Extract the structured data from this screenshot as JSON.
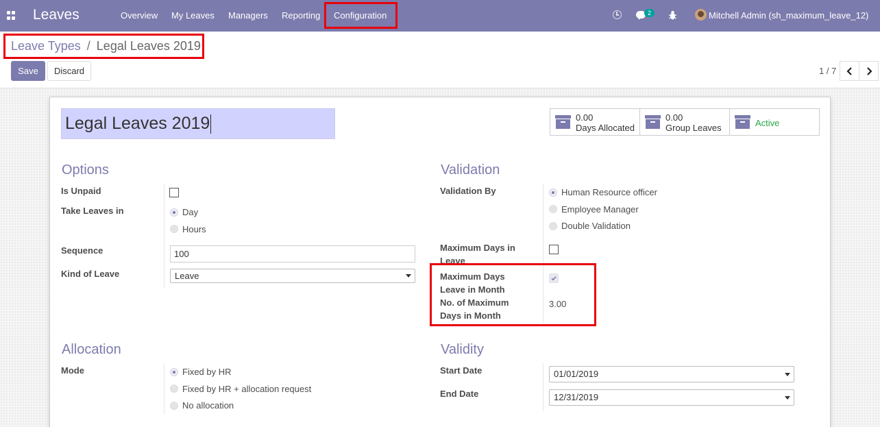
{
  "app": {
    "title": "Leaves"
  },
  "menu": [
    "Overview",
    "My Leaves",
    "Managers",
    "Reporting",
    "Configuration"
  ],
  "systray": {
    "chat_count": "2",
    "user": "Mitchell Admin (sh_maximum_leave_12)"
  },
  "breadcrumb": {
    "parent": "Leave Types",
    "separator": "/",
    "current": "Legal Leaves 2019"
  },
  "buttons": {
    "save": "Save",
    "discard": "Discard"
  },
  "pager": {
    "value": "1 / 7",
    "prev": "‹",
    "next": "›"
  },
  "record": {
    "name": "Legal Leaves 2019",
    "stats": [
      {
        "value": "0.00",
        "label": "Days Allocated"
      },
      {
        "value": "0.00",
        "label": "Group Leaves"
      },
      {
        "label": "Active"
      }
    ]
  },
  "options": {
    "title": "Options",
    "is_unpaid_label": "Is Unpaid",
    "is_unpaid": false,
    "take_leaves_label": "Take Leaves in",
    "take_leaves_options": [
      "Day",
      "Hours"
    ],
    "take_leaves_selected": "Day",
    "sequence_label": "Sequence",
    "sequence": "100",
    "kind_label": "Kind of Leave",
    "kind": "Leave"
  },
  "validation": {
    "title": "Validation",
    "validation_by_label": "Validation By",
    "validation_by_options": [
      "Human Resource officer",
      "Employee Manager",
      "Double Validation"
    ],
    "validation_by_selected": "Human Resource officer",
    "max_days_leave_label_1": "Maximum Days in",
    "max_days_leave_label_2": "Leave",
    "max_days_leave": false,
    "max_days_month_label_1": "Maximum Days",
    "max_days_month_label_2": "Leave in Month",
    "max_days_month": true,
    "no_max_days_label_1": "No. of Maximum",
    "no_max_days_label_2": "Days in Month",
    "no_max_days": "3.00"
  },
  "allocation": {
    "title": "Allocation",
    "mode_label": "Mode",
    "mode_options": [
      "Fixed by HR",
      "Fixed by HR + allocation request",
      "No allocation"
    ],
    "mode_selected": "Fixed by HR"
  },
  "validity": {
    "title": "Validity",
    "start_label": "Start Date",
    "start": "01/01/2019",
    "end_label": "End Date",
    "end": "12/31/2019"
  },
  "colors": {
    "brand": "#7c7bad",
    "highlight": "#e8000b",
    "active": "#28a745"
  }
}
